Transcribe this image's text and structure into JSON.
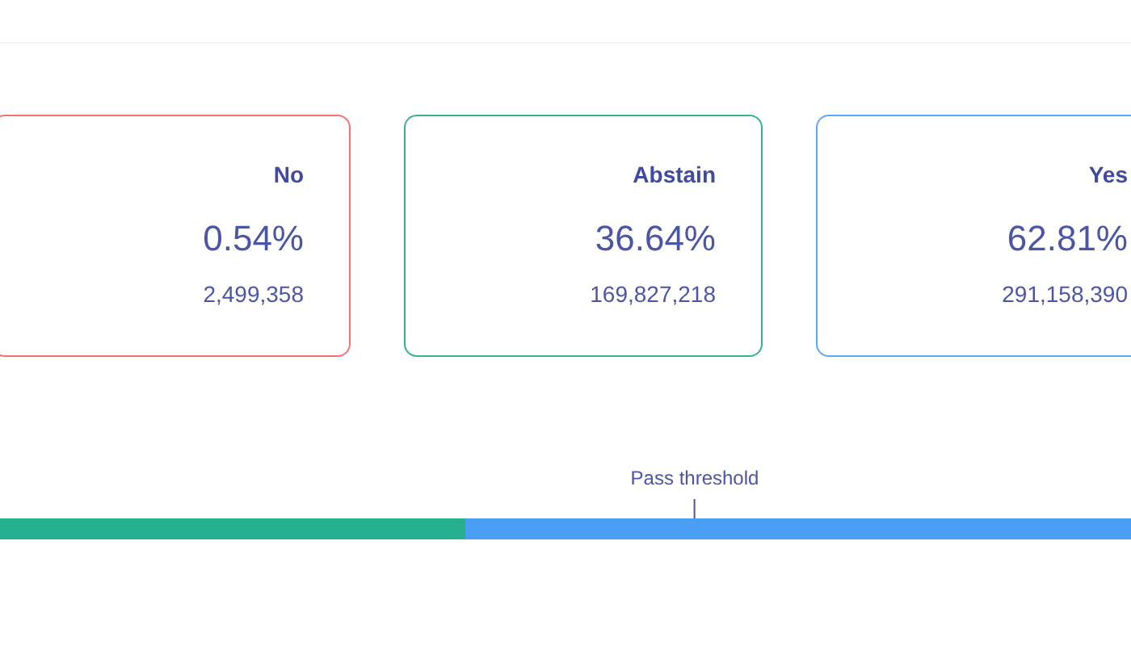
{
  "options": [
    {
      "label": "No",
      "percent": "0.54%",
      "votes": "2,499,358",
      "color": "#f87171"
    },
    {
      "label": "Abstain",
      "percent": "36.64%",
      "votes": "169,827,218",
      "color": "#34b38a"
    },
    {
      "label": "Yes",
      "percent": "62.81%",
      "votes": "291,158,390",
      "color": "#60a5fa"
    }
  ],
  "bar": {
    "segments": [
      {
        "color": "#26b08f"
      },
      {
        "color": "#4a9ff5"
      }
    ],
    "threshold_label": "Pass threshold"
  }
}
